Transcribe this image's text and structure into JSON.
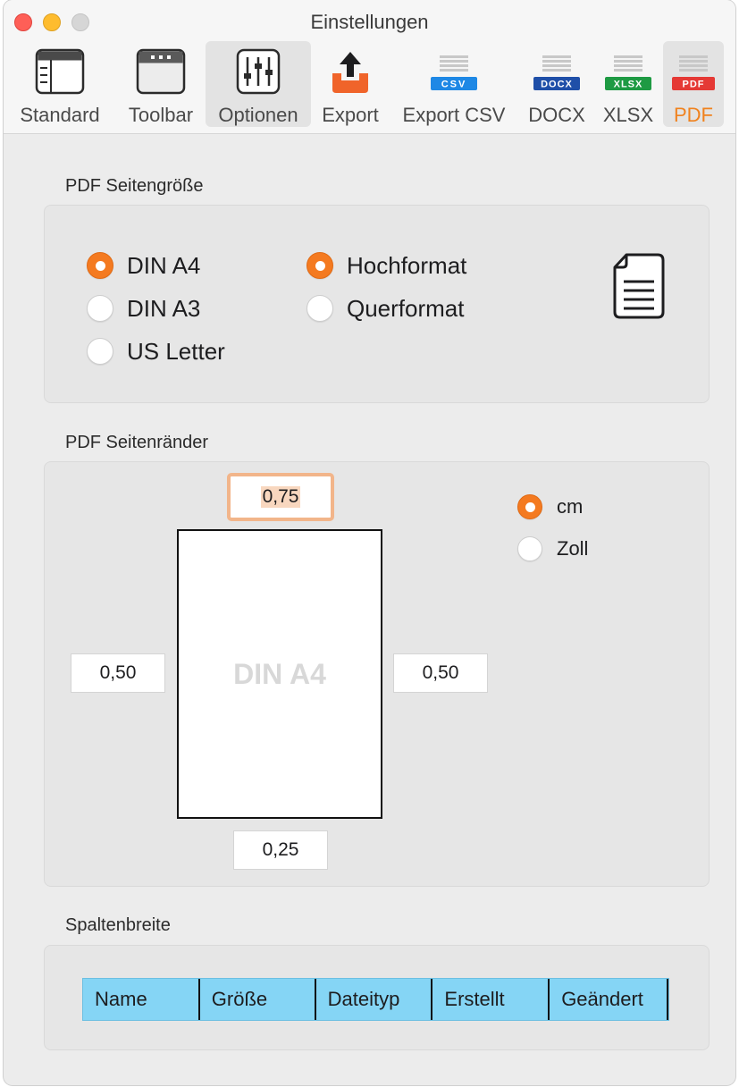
{
  "window": {
    "title": "Einstellungen"
  },
  "toolbar": {
    "items": [
      {
        "label": "Standard",
        "icon": "window-layout-icon"
      },
      {
        "label": "Toolbar",
        "icon": "toolbar-icon"
      },
      {
        "label": "Optionen",
        "icon": "sliders-icon"
      },
      {
        "label": "Export",
        "icon": "export-tray-icon"
      },
      {
        "label": "Export CSV",
        "icon": "csv-file-icon",
        "badge": "CSV"
      },
      {
        "label": "DOCX",
        "icon": "docx-file-icon",
        "badge": "DOCX"
      },
      {
        "label": "XLSX",
        "icon": "xlsx-file-icon",
        "badge": "XLSX"
      },
      {
        "label": "PDF",
        "icon": "pdf-file-icon",
        "badge": "PDF"
      }
    ],
    "selected": "PDF"
  },
  "page_size": {
    "section_label": "PDF Seitengröße",
    "sizes": [
      {
        "label": "DIN A4",
        "selected": true
      },
      {
        "label": "DIN A3",
        "selected": false
      },
      {
        "label": "US Letter",
        "selected": false
      }
    ],
    "orientations": [
      {
        "label": "Hochformat",
        "selected": true
      },
      {
        "label": "Querformat",
        "selected": false
      }
    ]
  },
  "margins": {
    "section_label": "PDF Seitenränder",
    "top": "0,75",
    "left": "0,50",
    "right": "0,50",
    "bottom": "0,25",
    "preview_label": "DIN A4",
    "units": [
      {
        "label": "cm",
        "selected": true
      },
      {
        "label": "Zoll",
        "selected": false
      }
    ]
  },
  "columns": {
    "section_label": "Spaltenbreite",
    "headers": [
      "Name",
      "Größe",
      "Dateityp",
      "Erstellt",
      "Geändert"
    ]
  },
  "colors": {
    "accent": "#f47a20",
    "column_bar": "#85d5f5",
    "csv_badge": "#1e88e5",
    "docx_badge": "#1f4fa8",
    "xlsx_badge": "#1e9a43",
    "pdf_badge": "#e53935",
    "export_tray": "#f0642a"
  }
}
